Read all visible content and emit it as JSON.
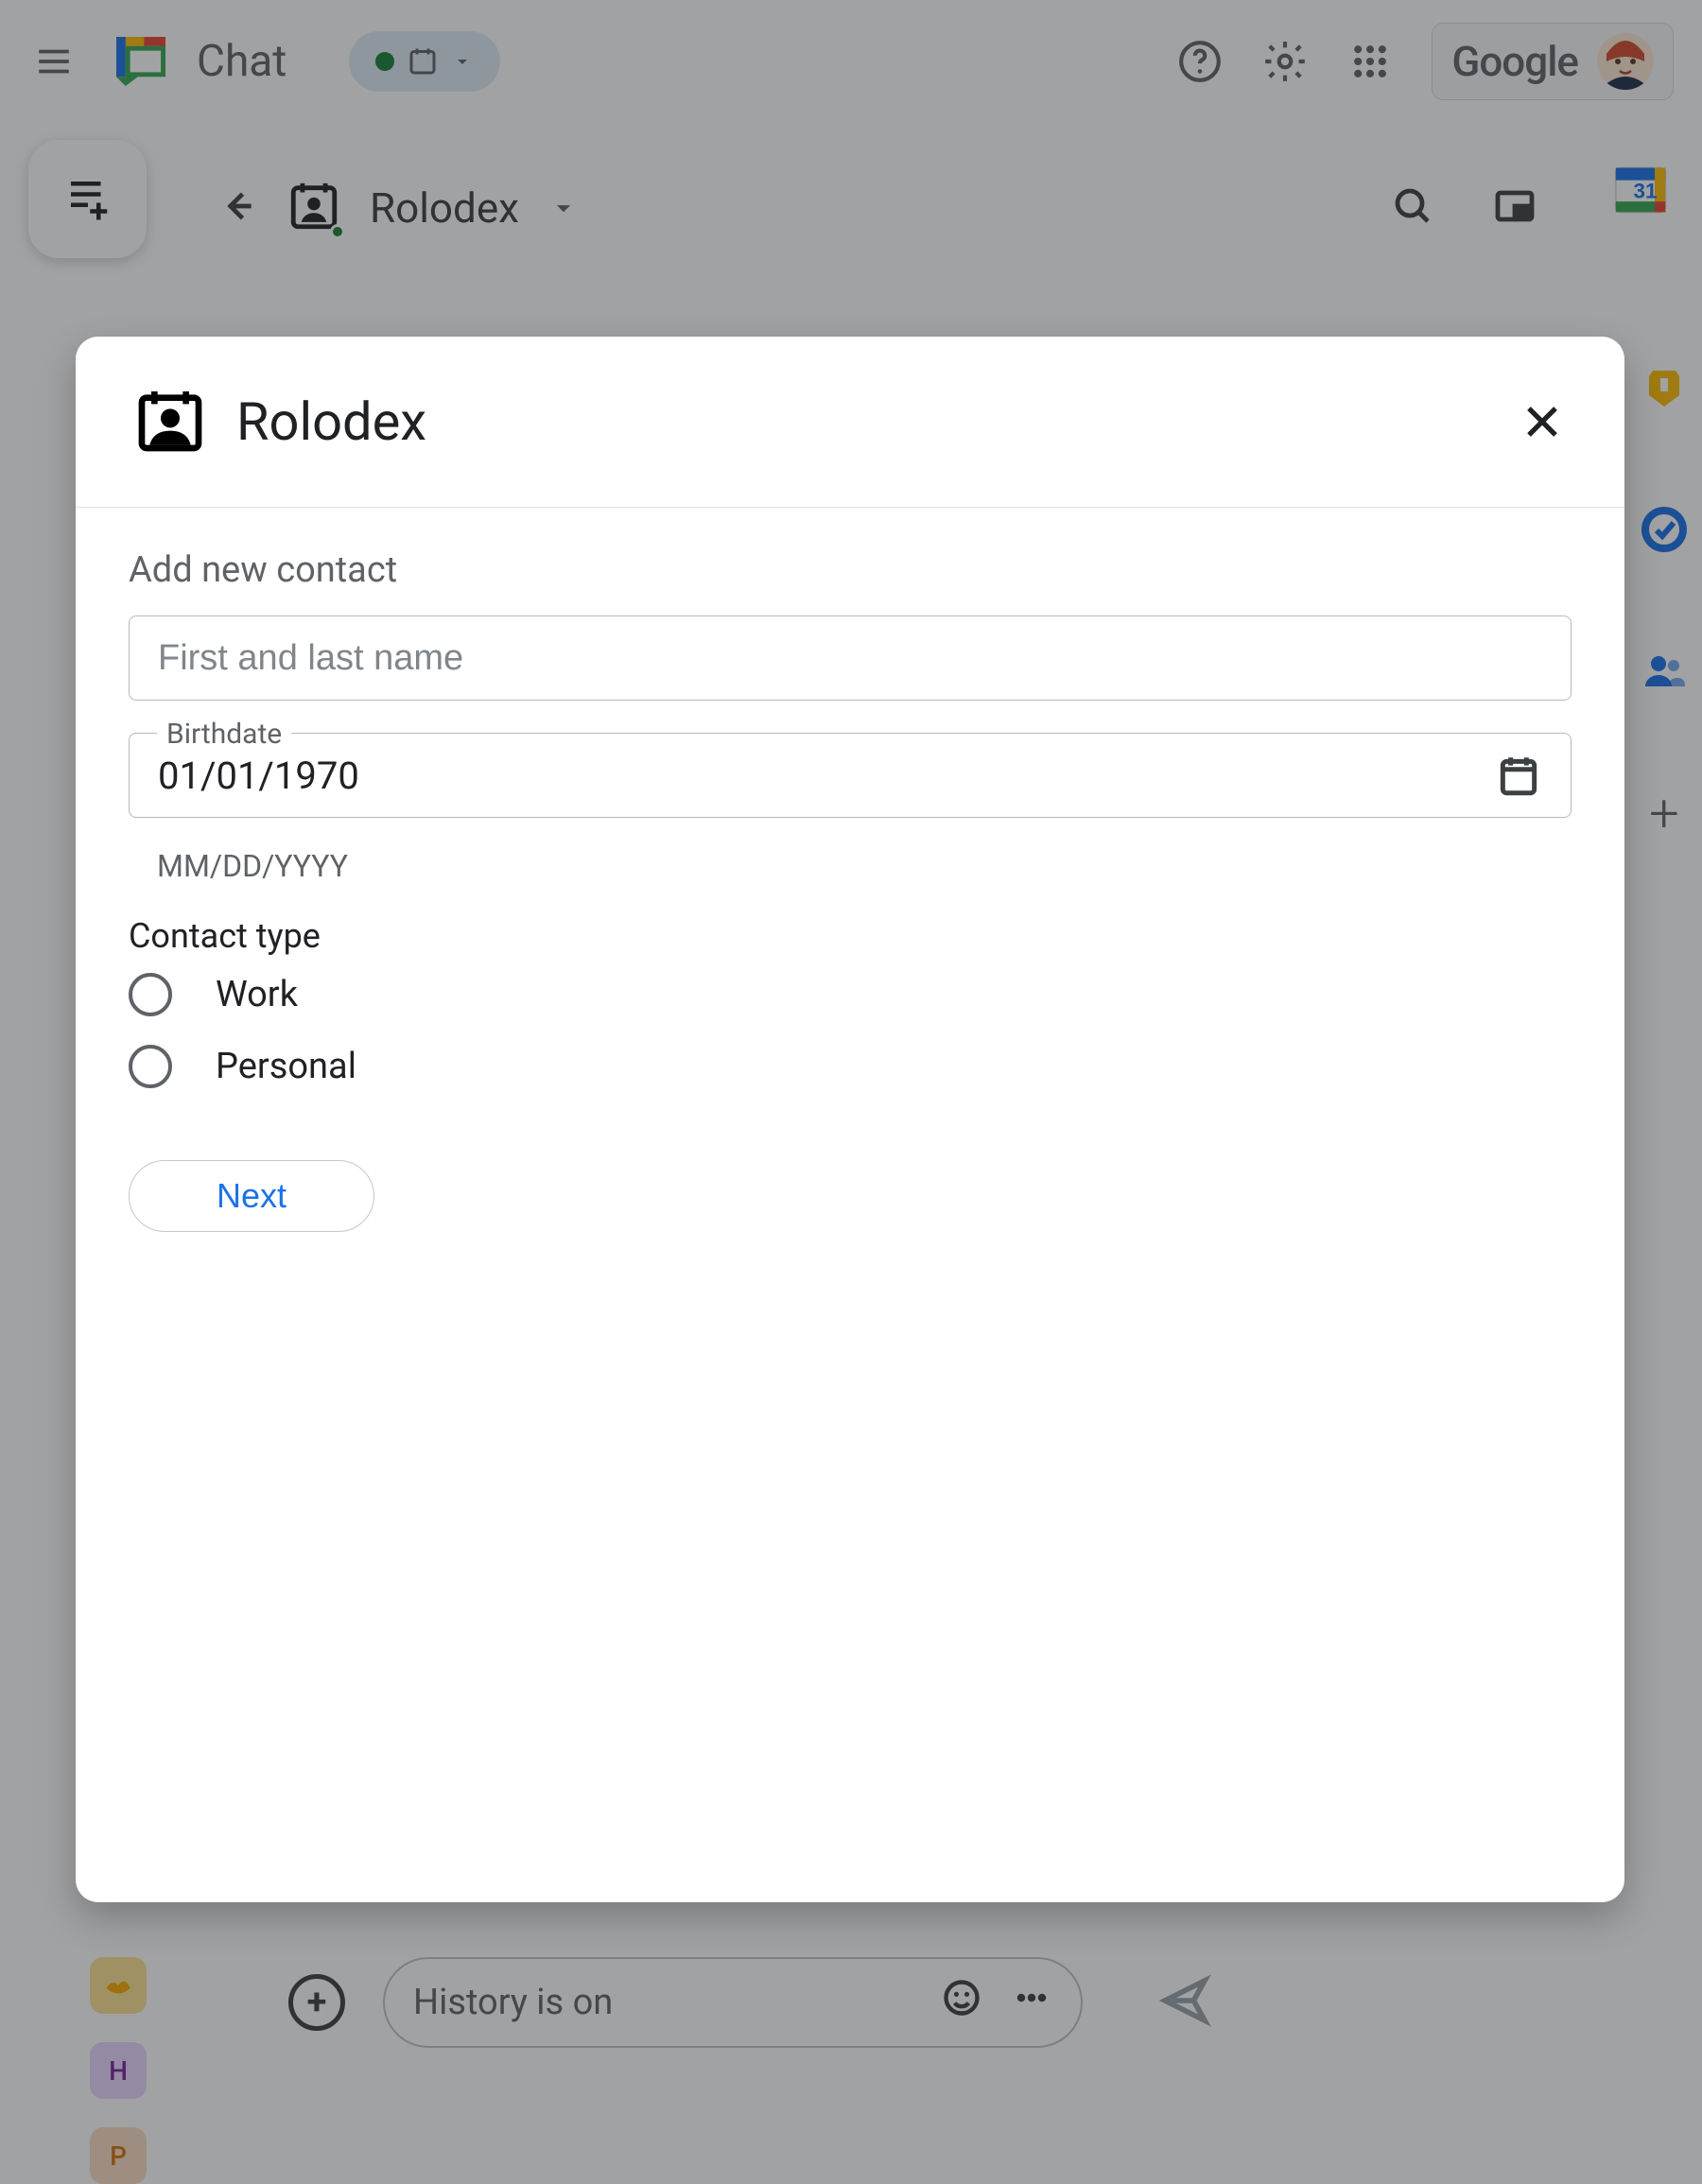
{
  "header": {
    "app_name": "Chat",
    "google_label": "Google"
  },
  "space": {
    "name": "Rolodex",
    "calendar_day": "31"
  },
  "rightbar": {
    "plus": "+"
  },
  "compose": {
    "placeholder": "History is on"
  },
  "avatar_stack": {
    "h": "H",
    "p": "P"
  },
  "modal": {
    "title": "Rolodex",
    "add_label": "Add new contact",
    "name_placeholder": "First and last name",
    "birthdate_label": "Birthdate",
    "birthdate_value": "01/01/1970",
    "birthdate_helper": "MM/DD/YYYY",
    "contact_type_label": "Contact type",
    "radio_work": "Work",
    "radio_personal": "Personal",
    "next_label": "Next"
  }
}
